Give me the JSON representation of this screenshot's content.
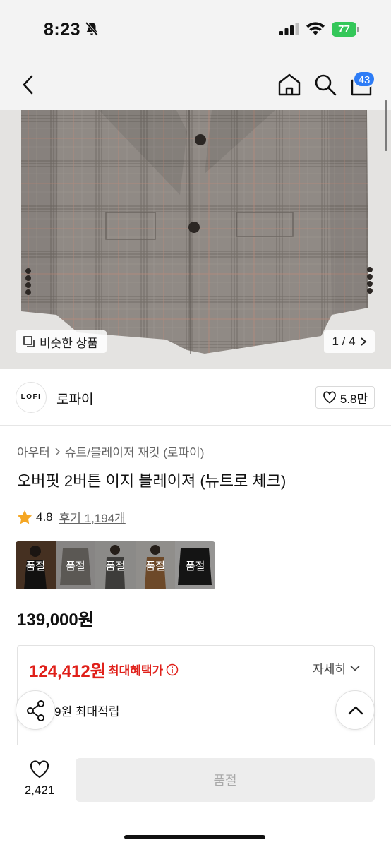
{
  "status_bar": {
    "time": "8:23",
    "battery": "77"
  },
  "header": {
    "cart_count": "43"
  },
  "image": {
    "similar_label": "비슷한 상품",
    "page_indicator": "1 / 4"
  },
  "brand": {
    "logo_text": "LOFI",
    "name": "로파이",
    "likes": "5.8만"
  },
  "breadcrumb": {
    "items": [
      "아우터",
      "슈트/블레이저 재킷 (로파이)"
    ]
  },
  "product": {
    "title": "오버핏 2버튼 이지 블레이져 (뉴트로 체크)",
    "price": "139,000원"
  },
  "rating": {
    "score": "4.8",
    "reviews": "후기 1,194개"
  },
  "colors": {
    "soldout_label": "품절",
    "swatches": [
      {
        "bg": "#6b4a33"
      },
      {
        "bg": "#8d8781"
      },
      {
        "bg": "#6a6864"
      },
      {
        "bg": "#a8703f"
      },
      {
        "bg": "#1f1f1f"
      }
    ]
  },
  "benefit": {
    "sale_price": "124,412원",
    "sale_label": "최대혜택가",
    "detail_label": "자세히",
    "points": "9원 최대적립"
  },
  "bottom": {
    "wish_count": "2,421",
    "buy_label": "품절"
  },
  "colors_theme": {
    "accent_red": "#e0201a",
    "badge_blue": "#2d7cf6"
  }
}
